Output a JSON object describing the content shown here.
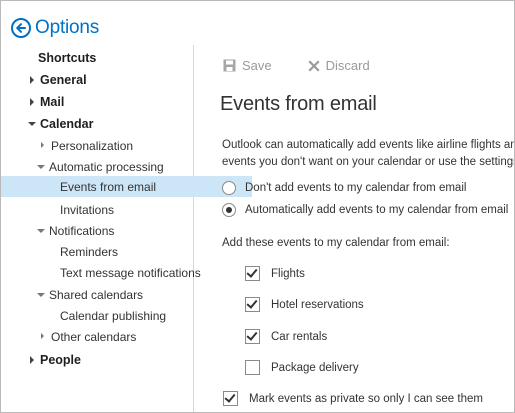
{
  "header": {
    "title": "Options",
    "back_icon": "back-arrow-circle-icon",
    "accent_color": "#0072c6"
  },
  "sidebar": {
    "items": [
      {
        "label": "Shortcuts"
      },
      {
        "label": "General"
      },
      {
        "label": "Mail"
      },
      {
        "label": "Calendar"
      },
      {
        "label": "Personalization"
      },
      {
        "label": "Automatic processing"
      },
      {
        "label": "Events from email"
      },
      {
        "label": "Invitations"
      },
      {
        "label": "Notifications"
      },
      {
        "label": "Reminders"
      },
      {
        "label": "Text message notifications"
      },
      {
        "label": "Shared calendars"
      },
      {
        "label": "Calendar publishing"
      },
      {
        "label": "Other calendars"
      },
      {
        "label": "People"
      }
    ],
    "selected_color": "#cde6f7"
  },
  "toolbar": {
    "save_label": "Save",
    "discard_label": "Discard"
  },
  "main": {
    "title": "Events from email",
    "description_line1": "Outlook can automatically add events like airline flights an",
    "description_line2": "events you don't want on your calendar or use the settings",
    "radio_options": [
      {
        "label": "Don't add events to my calendar from email",
        "selected": false
      },
      {
        "label": "Automatically add events to my calendar from email",
        "selected": true
      }
    ],
    "section_label": "Add these events to my calendar from email:",
    "event_types": [
      {
        "label": "Flights",
        "checked": true
      },
      {
        "label": "Hotel reservations",
        "checked": true
      },
      {
        "label": "Car rentals",
        "checked": true
      },
      {
        "label": "Package delivery",
        "checked": false
      }
    ],
    "private_option": {
      "label": "Mark events as private so only I can see them",
      "checked": true
    }
  }
}
